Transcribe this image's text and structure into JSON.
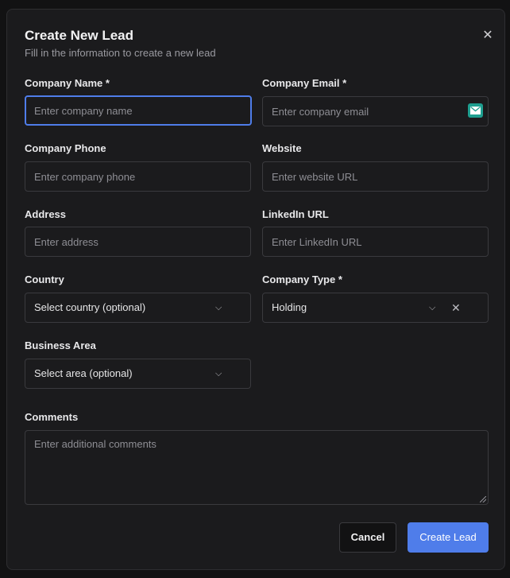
{
  "dialog": {
    "title": "Create New Lead",
    "subtitle": "Fill in the information to create a new lead",
    "close_icon": "close-icon"
  },
  "fields": {
    "company_name": {
      "label": "Company Name *",
      "placeholder": "Enter company name"
    },
    "company_email": {
      "label": "Company Email *",
      "placeholder": "Enter company email",
      "icon": "email-autofill-icon"
    },
    "company_phone": {
      "label": "Company Phone",
      "placeholder": "Enter company phone"
    },
    "website": {
      "label": "Website",
      "placeholder": "Enter website URL"
    },
    "address": {
      "label": "Address",
      "placeholder": "Enter address"
    },
    "linkedin": {
      "label": "LinkedIn URL",
      "placeholder": "Enter LinkedIn URL"
    },
    "country": {
      "label": "Country",
      "value": "Select country (optional)"
    },
    "company_type": {
      "label": "Company Type *",
      "value": "Holding"
    },
    "business_area": {
      "label": "Business Area",
      "value": "Select area (optional)"
    },
    "comments": {
      "label": "Comments",
      "placeholder": "Enter additional comments"
    }
  },
  "actions": {
    "cancel_label": "Cancel",
    "create_label": "Create Lead"
  },
  "colors": {
    "accent": "#4f7dea",
    "surface": "#1b1b1d",
    "border": "#3a3a3e",
    "email_icon": "#1e9e8f"
  }
}
